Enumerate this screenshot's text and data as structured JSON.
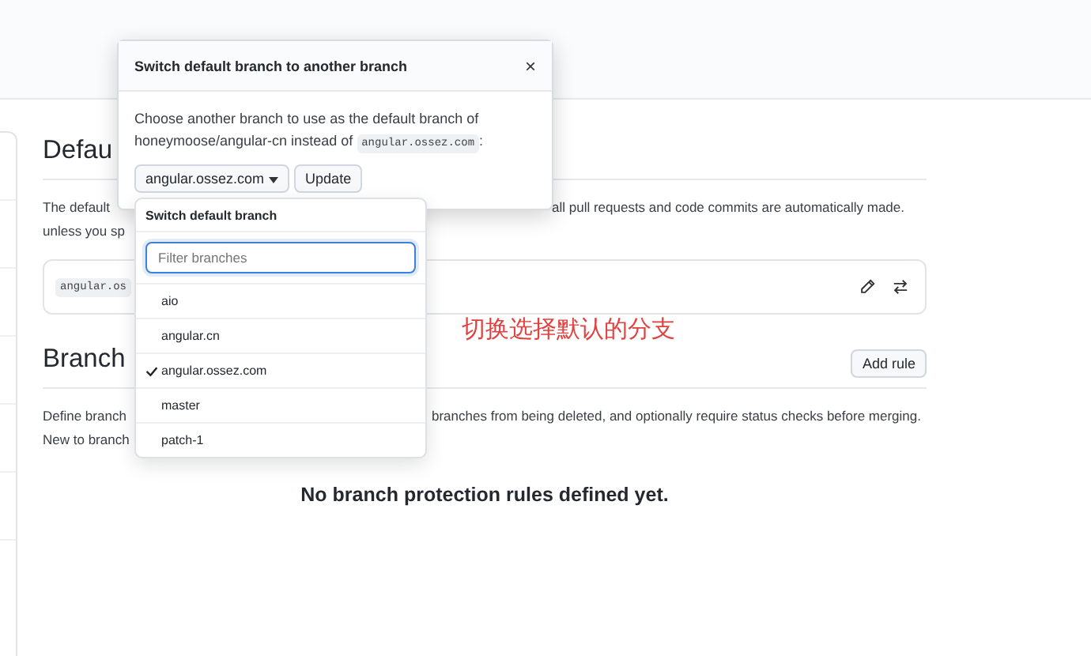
{
  "default_section": {
    "heading": "Defau",
    "line_1_left": "The default",
    "line_1_right": "all pull requests and code commits are automatically made.",
    "line_2": "unless you sp",
    "branch_code": "angular.os"
  },
  "protection_section": {
    "heading": "Branch",
    "add_button": "Add rule",
    "line_1_left": "Define branch",
    "line_1_right": "branches from being deleted, and optionally require status checks before merging.",
    "line_2": "New to branch",
    "empty_message": "No branch protection rules defined yet."
  },
  "annotation": "切换选择默认的分支",
  "dialog": {
    "title": "Switch default branch to another branch",
    "close": "×",
    "text_before": "Choose another branch to use as the default branch of honeymoose/angular-cn instead of",
    "current_branch": "angular.ossez.com",
    "text_after": ":",
    "branch_button": "angular.ossez.com",
    "update_button": "Update"
  },
  "menu": {
    "title": "Switch default branch",
    "filter": {
      "placeholder": "Filter branches"
    },
    "items": [
      {
        "label": "aio",
        "selected": false
      },
      {
        "label": "angular.cn",
        "selected": false
      },
      {
        "label": "angular.ossez.com",
        "selected": true
      },
      {
        "label": "master",
        "selected": false
      },
      {
        "label": "patch-1",
        "selected": false
      }
    ]
  }
}
